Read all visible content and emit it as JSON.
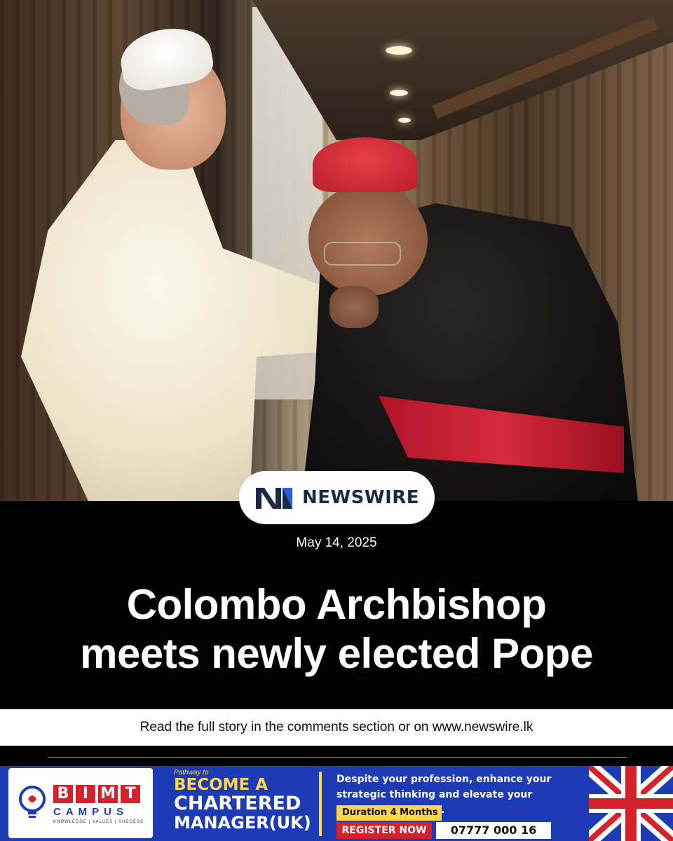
{
  "logo": {
    "text": "NEWSWIRE",
    "brand_color": "#1b2a44",
    "accent": "#2b5fd9"
  },
  "date": "May 14, 2025",
  "headline": {
    "line1": "Colombo Archbishop",
    "line2": "meets newly elected Pope"
  },
  "read_more": "Read the full story in the comments section or on www.newswire.lk",
  "ad": {
    "brand_letters": [
      "B",
      "I",
      "M",
      "T"
    ],
    "brand_sub": "CAMPUS",
    "brand_tagline": "KNOWLEDGE | VALUES | SUCCESS",
    "pathway": "Pathway to",
    "line1": "BECOME A",
    "line2": "CHARTERED",
    "line3": "MANAGER(UK)",
    "copy": "Despite your profession, enhance your strategic thinking and elevate your management skills.",
    "duration": "Duration 4 Months",
    "cta": "REGISTER NOW",
    "phone": "07777 000 16",
    "colors": {
      "background": "#1d3bb4",
      "highlight": "#ffd54a",
      "red": "#d4212a"
    }
  }
}
